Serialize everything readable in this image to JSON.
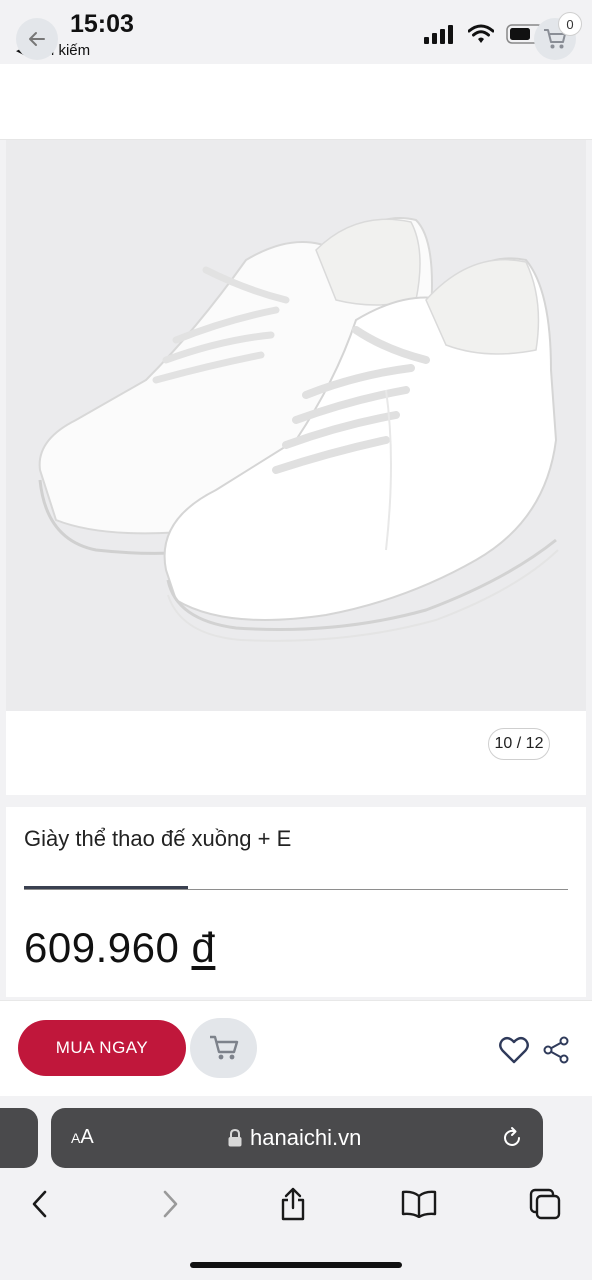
{
  "status_bar": {
    "time": "15:03",
    "back_label": "Tìm kiếm",
    "back_glyph": "◀"
  },
  "header": {
    "cart_count": "0"
  },
  "gallery": {
    "counter": "10 / 12"
  },
  "product": {
    "name": "Giày thể thao đế xuồng + E",
    "price_amount": "609.960",
    "price_currency": "đ"
  },
  "actions": {
    "buy_now_label": "MUA NGAY"
  },
  "browser": {
    "aa_small": "A",
    "aa_large": "A",
    "url": "hanaichi.vn"
  },
  "colors": {
    "brand_red": "#c0173b",
    "icon_blue": "#2f3a5a",
    "chrome_gray": "#4a4a4c"
  }
}
